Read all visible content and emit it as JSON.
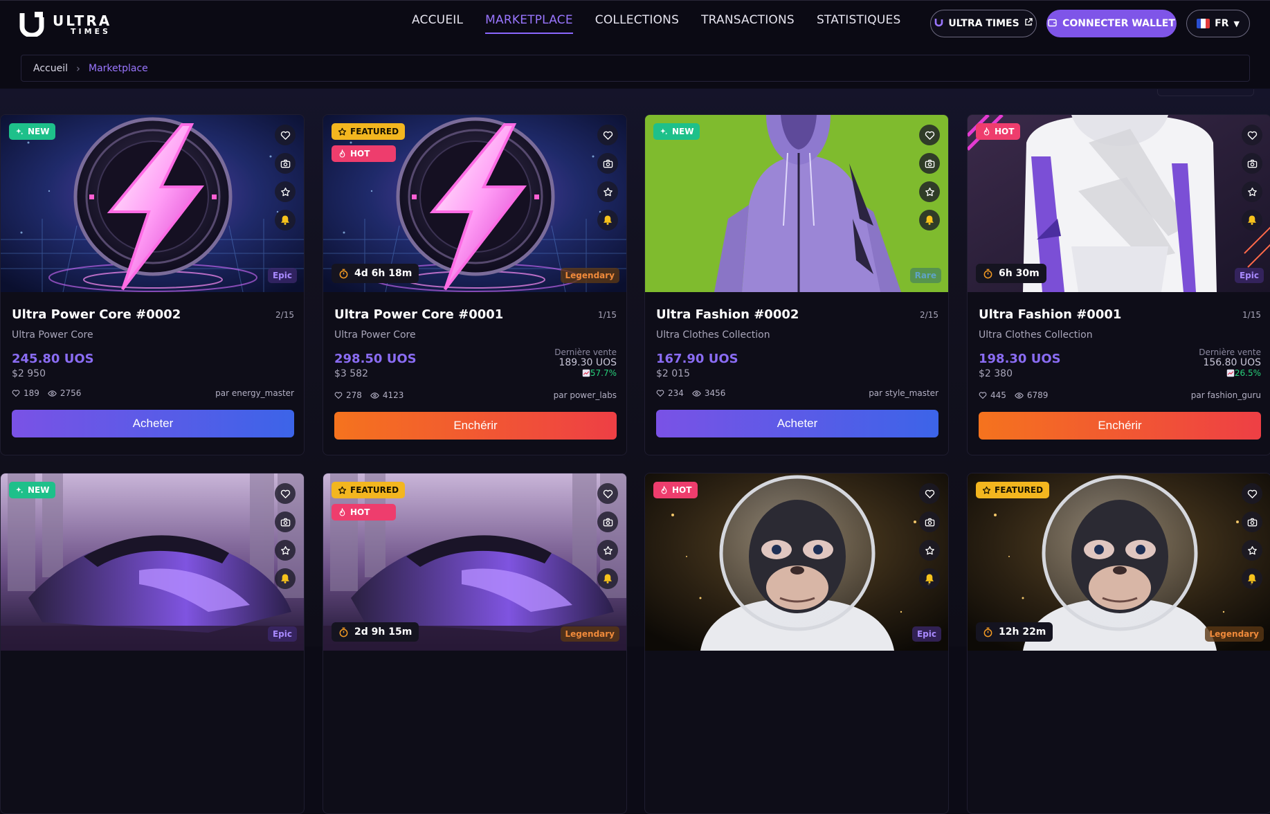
{
  "header": {
    "logo_line1": "ULTRA",
    "logo_line2": "TIMES",
    "nav": [
      "ACCUEIL",
      "MARKETPLACE",
      "COLLECTIONS",
      "TRANSACTIONS",
      "STATISTIQUES"
    ],
    "active_nav": "MARKETPLACE",
    "times_button": "ULTRA TIMES",
    "wallet_button": "CONNECTER WALLET",
    "lang_button": "FR"
  },
  "breadcrumb": {
    "home": "Accueil",
    "separator": "›",
    "current": "Marketplace"
  },
  "colors": {
    "accent": "#8b67ff",
    "wallet": "#7f55e8",
    "new": "#1ec08a",
    "hot": "#ee3d6d",
    "featured": "#f3b61f",
    "gain": "#27d07a"
  },
  "cards": [
    {
      "badges": [
        "NEW"
      ],
      "rarity": "Epic",
      "title": "Ultra Power Core #0002",
      "edition": "2/15",
      "collection": "Ultra Power Core",
      "price": "245.80 UOS",
      "usd": "$2 950",
      "likes": "189",
      "views": "2756",
      "author": "par energy_master",
      "cta": "Acheter",
      "image": "lightning-coin"
    },
    {
      "badges": [
        "FEATURED",
        "HOT"
      ],
      "timer": "4d 6h 18m",
      "rarity": "Legendary",
      "title": "Ultra Power Core #0001",
      "edition": "1/15",
      "collection": "Ultra Power Core",
      "price": "298.50 UOS",
      "usd": "$3 582",
      "last_label": "Dernière vente",
      "last_price": "189.30 UOS",
      "last_change": "57.7%",
      "likes": "278",
      "views": "4123",
      "author": "par power_labs",
      "cta": "Enchérir",
      "image": "lightning-coin"
    },
    {
      "badges": [
        "NEW"
      ],
      "rarity": "Rare",
      "title": "Ultra Fashion #0002",
      "edition": "2/15",
      "collection": "Ultra Clothes Collection",
      "price": "167.90 UOS",
      "usd": "$2 015",
      "likes": "234",
      "views": "3456",
      "author": "par style_master",
      "cta": "Acheter",
      "image": "purple-hoodie"
    },
    {
      "badges": [
        "HOT"
      ],
      "timer": "6h 30m",
      "rarity": "Epic",
      "title": "Ultra Fashion #0001",
      "edition": "1/15",
      "collection": "Ultra Clothes Collection",
      "price": "198.30 UOS",
      "usd": "$2 380",
      "last_label": "Dernière vente",
      "last_price": "156.80 UOS",
      "last_change": "26.5%",
      "likes": "445",
      "views": "6789",
      "author": "par fashion_guru",
      "cta": "Enchérir",
      "image": "white-hoodie"
    },
    {
      "badges": [
        "NEW"
      ],
      "rarity": "Epic",
      "image": "yacht"
    },
    {
      "badges": [
        "FEATURED",
        "HOT"
      ],
      "timer": "2d 9h 15m",
      "rarity": "Legendary",
      "image": "yacht"
    },
    {
      "badges": [
        "HOT"
      ],
      "rarity": "Epic",
      "image": "space-monkey"
    },
    {
      "badges": [
        "FEATURED"
      ],
      "timer": "12h 22m",
      "rarity": "Legendary",
      "image": "space-monkey"
    }
  ]
}
